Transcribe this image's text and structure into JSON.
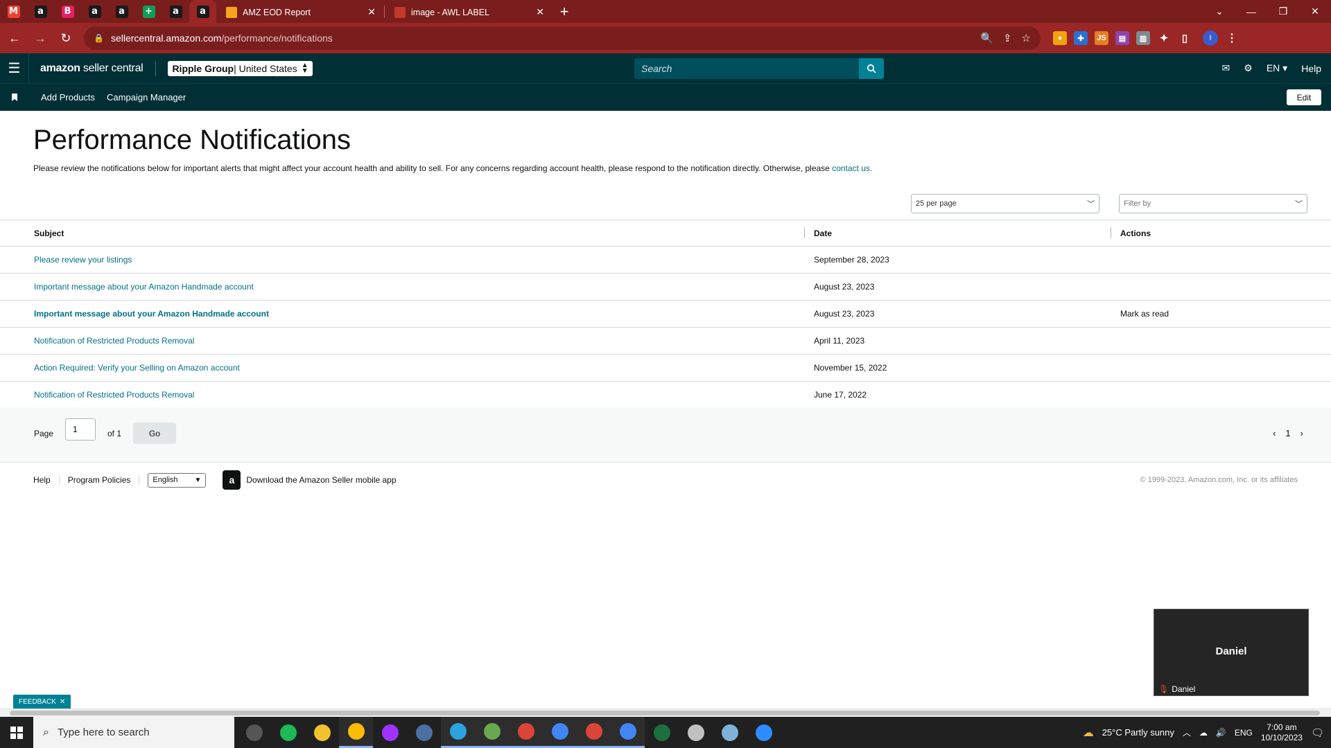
{
  "browser": {
    "pinned_tabs": [
      {
        "icon": "gmail-icon",
        "glyph": "M",
        "color": "#ea4335"
      },
      {
        "icon": "amazon-icon",
        "glyph": "a",
        "color": "#1a1a1a"
      },
      {
        "icon": "b-app-icon",
        "glyph": "B",
        "color": "#e91e63"
      },
      {
        "icon": "amazon-icon",
        "glyph": "a",
        "color": "#1a1a1a"
      },
      {
        "icon": "amazon-icon",
        "glyph": "a",
        "color": "#1a1a1a"
      },
      {
        "icon": "sheets-icon",
        "glyph": "+",
        "color": "#0f9d58"
      },
      {
        "icon": "amazon-icon",
        "glyph": "a",
        "color": "#1a1a1a"
      },
      {
        "icon": "amazon-icon",
        "glyph": "a",
        "color": "#1a1a1a"
      }
    ],
    "tabs": [
      {
        "title": "AMZ EOD Report",
        "favicon_color": "#f4a51c"
      },
      {
        "title": "image - AWL LABEL",
        "favicon_color": "#c0392b"
      }
    ],
    "url_host": "sellercentral.amazon.com",
    "url_path": "/performance/notifications",
    "profile_initial": "I"
  },
  "header": {
    "logo_brand": "amazon",
    "logo_product": " seller central",
    "account_name": "Ripple Group",
    "account_region": " | United States",
    "search_placeholder": "Search",
    "lang": "EN",
    "help": "Help"
  },
  "bookmarks": {
    "items": [
      "Add Products",
      "Campaign Manager"
    ],
    "edit": "Edit"
  },
  "main": {
    "title": "Performance Notifications",
    "intro": "Please review the notifications below for important alerts that might affect your account health and ability to sell. For any concerns regarding account health, please respond to the notification directly. Otherwise, please ",
    "intro_link": "contact us.",
    "per_page": "25 per page",
    "filter": "Filter by",
    "columns": {
      "subject": "Subject",
      "date": "Date",
      "actions": "Actions"
    },
    "rows": [
      {
        "subject": "Please review your listings",
        "date": "September 28, 2023",
        "action": "",
        "unread": false
      },
      {
        "subject": "Important message about your Amazon Handmade account",
        "date": "August 23, 2023",
        "action": "",
        "unread": false
      },
      {
        "subject": "Important message about your Amazon Handmade account",
        "date": "August 23, 2023",
        "action": "Mark as read",
        "unread": true
      },
      {
        "subject": "Notification of Restricted Products Removal",
        "date": "April 11, 2023",
        "action": "",
        "unread": false
      },
      {
        "subject": "Action Required: Verify your Selling on Amazon account",
        "date": "November 15, 2022",
        "action": "",
        "unread": false
      },
      {
        "subject": "Notification of Restricted Products Removal",
        "date": "June 17, 2022",
        "action": "",
        "unread": false
      }
    ]
  },
  "pager": {
    "page_label": "Page",
    "page_value": "1",
    "of_label": "of 1",
    "go": "Go",
    "current": "1"
  },
  "footer": {
    "help": "Help",
    "policies": "Program Policies",
    "language": "English",
    "app_text": "Download the Amazon Seller mobile app",
    "copyright": "© 1999-2023, Amazon.com, Inc. or its affiliates"
  },
  "feedback": "FEEDBACK",
  "video": {
    "name": "Daniel",
    "label": "Daniel"
  },
  "taskbar": {
    "search_placeholder": "Type here to search",
    "weather": "25°C  Partly sunny",
    "lang": "ENG",
    "time": "7:00 am",
    "date": "10/10/2023",
    "apps": [
      {
        "name": "task-view-icon",
        "color": "#555"
      },
      {
        "name": "spotify-icon",
        "color": "#1db954"
      },
      {
        "name": "file-explorer-icon",
        "color": "#f2c12e"
      },
      {
        "name": "chrome-icon",
        "color": "#fbbc05"
      },
      {
        "name": "messenger-icon",
        "color": "#a033ff"
      },
      {
        "name": "calculator-icon",
        "color": "#4a6fa5"
      },
      {
        "name": "telegram-icon",
        "color": "#2aa3de"
      },
      {
        "name": "utorrent-icon",
        "color": "#6aa84f"
      },
      {
        "name": "chrome-profile-icon",
        "color": "#db4437"
      },
      {
        "name": "chrome-profile-icon",
        "color": "#4285f4"
      },
      {
        "name": "chrome-profile-icon",
        "color": "#db4437"
      },
      {
        "name": "chrome-profile-icon",
        "color": "#4285f4"
      },
      {
        "name": "excel-icon",
        "color": "#1d6f42"
      },
      {
        "name": "paint-icon",
        "color": "#c0c0c0"
      },
      {
        "name": "notepad-icon",
        "color": "#7fb2d9"
      },
      {
        "name": "zoom-icon",
        "color": "#2d8cff"
      }
    ]
  }
}
